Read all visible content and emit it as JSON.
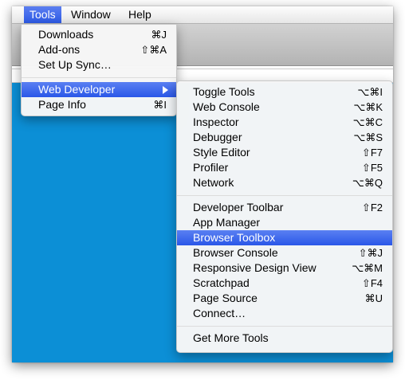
{
  "menubar": {
    "items": [
      {
        "label": "Tools"
      },
      {
        "label": "Window"
      },
      {
        "label": "Help"
      }
    ]
  },
  "tools_menu": {
    "items": [
      {
        "label": "Downloads",
        "shortcut": "⌘J"
      },
      {
        "label": "Add-ons",
        "shortcut": "⇧⌘A"
      },
      {
        "label": "Set Up Sync…",
        "shortcut": ""
      },
      {
        "label": "Web Developer",
        "shortcut": ""
      },
      {
        "label": "Page Info",
        "shortcut": "⌘I"
      }
    ]
  },
  "web_developer_menu": {
    "items": [
      {
        "label": "Toggle Tools",
        "shortcut": "⌥⌘I"
      },
      {
        "label": "Web Console",
        "shortcut": "⌥⌘K"
      },
      {
        "label": "Inspector",
        "shortcut": "⌥⌘C"
      },
      {
        "label": "Debugger",
        "shortcut": "⌥⌘S"
      },
      {
        "label": "Style Editor",
        "shortcut": "⇧F7"
      },
      {
        "label": "Profiler",
        "shortcut": "⇧F5"
      },
      {
        "label": "Network",
        "shortcut": "⌥⌘Q"
      },
      {
        "label": "Developer Toolbar",
        "shortcut": "⇧F2"
      },
      {
        "label": "App Manager",
        "shortcut": ""
      },
      {
        "label": "Browser Toolbox",
        "shortcut": ""
      },
      {
        "label": "Browser Console",
        "shortcut": "⇧⌘J"
      },
      {
        "label": "Responsive Design View",
        "shortcut": "⌥⌘M"
      },
      {
        "label": "Scratchpad",
        "shortcut": "⇧F4"
      },
      {
        "label": "Page Source",
        "shortcut": "⌘U"
      },
      {
        "label": "Connect…",
        "shortcut": ""
      },
      {
        "label": "Get More Tools",
        "shortcut": ""
      }
    ]
  },
  "colors": {
    "highlight": "#2a57e8",
    "content_background": "#0c8fd6"
  }
}
